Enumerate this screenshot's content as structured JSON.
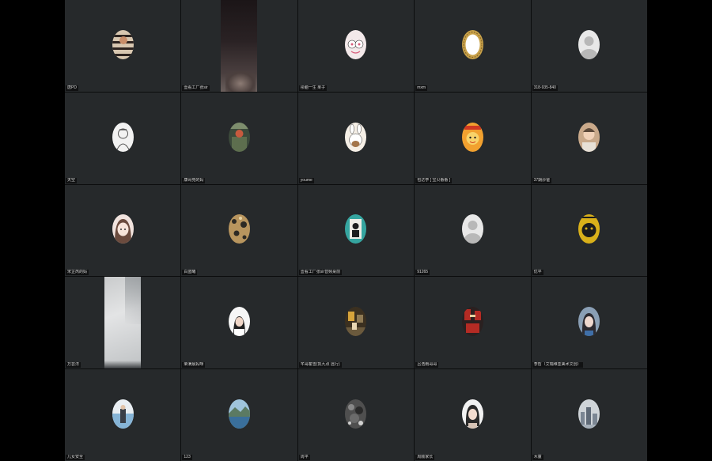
{
  "participants": [
    {
      "name": "唐PD",
      "avatar": "photo-striped",
      "colors": [
        "#2e2420",
        "#d8c7b0"
      ]
    },
    {
      "name": "壹看工厂张sir",
      "avatar": "video-dark",
      "colors": [
        "#1b1517",
        "#6a5f5c"
      ]
    },
    {
      "name": "彤脑一生 果子",
      "avatar": "cartoon-pink",
      "colors": [
        "#f3e9ea",
        "#d85e7b"
      ]
    },
    {
      "name": "mxm",
      "avatar": "gold-frame",
      "colors": [
        "#c9a24a",
        "#ffffff"
      ]
    },
    {
      "name": "318-935-840",
      "avatar": "default-person",
      "colors": [
        "#e8e8e8",
        "#b8b8b8"
      ]
    },
    {
      "name": "天空",
      "avatar": "sketch",
      "colors": [
        "#f2f2f2",
        "#555555"
      ]
    },
    {
      "name": "康哥竞的妈",
      "avatar": "photo-green",
      "colors": [
        "#3c4a3b",
        "#c75a3e"
      ]
    },
    {
      "name": "youme",
      "avatar": "cartoon-bunny",
      "colors": [
        "#f5efe6",
        "#a3754a"
      ]
    },
    {
      "name": "包达亭 [ 宝贝番番 ]",
      "avatar": "cartoon-orange",
      "colors": [
        "#f2a12f",
        "#d13a22"
      ]
    },
    {
      "name": "37期炒爸",
      "avatar": "photo-child",
      "colors": [
        "#c9a98a",
        "#5d4a3a"
      ]
    },
    {
      "name": "宋芷芮的妈",
      "avatar": "anime-girl",
      "colors": [
        "#f1e3de",
        "#6b4b3e"
      ]
    },
    {
      "name": "白蓝曦",
      "avatar": "photo-floral",
      "colors": [
        "#b8955e",
        "#2d2a24"
      ]
    },
    {
      "name": "壹看工厂张sir音频桌前",
      "avatar": "photo-poster",
      "colors": [
        "#35a5a0",
        "#1e1e1e"
      ]
    },
    {
      "name": "91265",
      "avatar": "default-person",
      "colors": [
        "#e8e8e8",
        "#b8b8b8"
      ]
    },
    {
      "name": "优平",
      "avatar": "photo-yellow",
      "colors": [
        "#d9b01a",
        "#1c1c1c"
      ]
    },
    {
      "name": "万芸洋",
      "avatar": "video-light",
      "colors": [
        "#c9cbcc",
        "#3a3d40"
      ]
    },
    {
      "name": "荣满晨妈咪",
      "avatar": "photo-girl-white",
      "colors": [
        "#f6f6f6",
        "#202020"
      ]
    },
    {
      "name": "芊哥瞿雪(凯九点 远行)",
      "avatar": "photo-street",
      "colors": [
        "#3b3020",
        "#d7a43b"
      ]
    },
    {
      "name": "吕浩雨哥哥",
      "avatar": "photo-red",
      "colors": [
        "#b42b24",
        "#2a2020"
      ]
    },
    {
      "name": "李哲（艾瑞维亚美术文创）",
      "avatar": "photo-woman",
      "colors": [
        "#8a9fb5",
        "#2c2a30"
      ]
    },
    {
      "name": "儿女安全",
      "avatar": "photo-sea",
      "colors": [
        "#86b4d6",
        "#e9eef2"
      ]
    },
    {
      "name": "123",
      "avatar": "photo-lake",
      "colors": [
        "#3a6f9b",
        "#9fc4dc"
      ]
    },
    {
      "name": "周平",
      "avatar": "photo-texture",
      "colors": [
        "#4f4f4f",
        "#d0d0d0"
      ]
    },
    {
      "name": "周顺家长",
      "avatar": "photo-woman-2",
      "colors": [
        "#f2f2f2",
        "#2a2a2a"
      ]
    },
    {
      "name": "木童",
      "avatar": "photo-city",
      "colors": [
        "#cfd4d8",
        "#7b8693"
      ]
    }
  ]
}
